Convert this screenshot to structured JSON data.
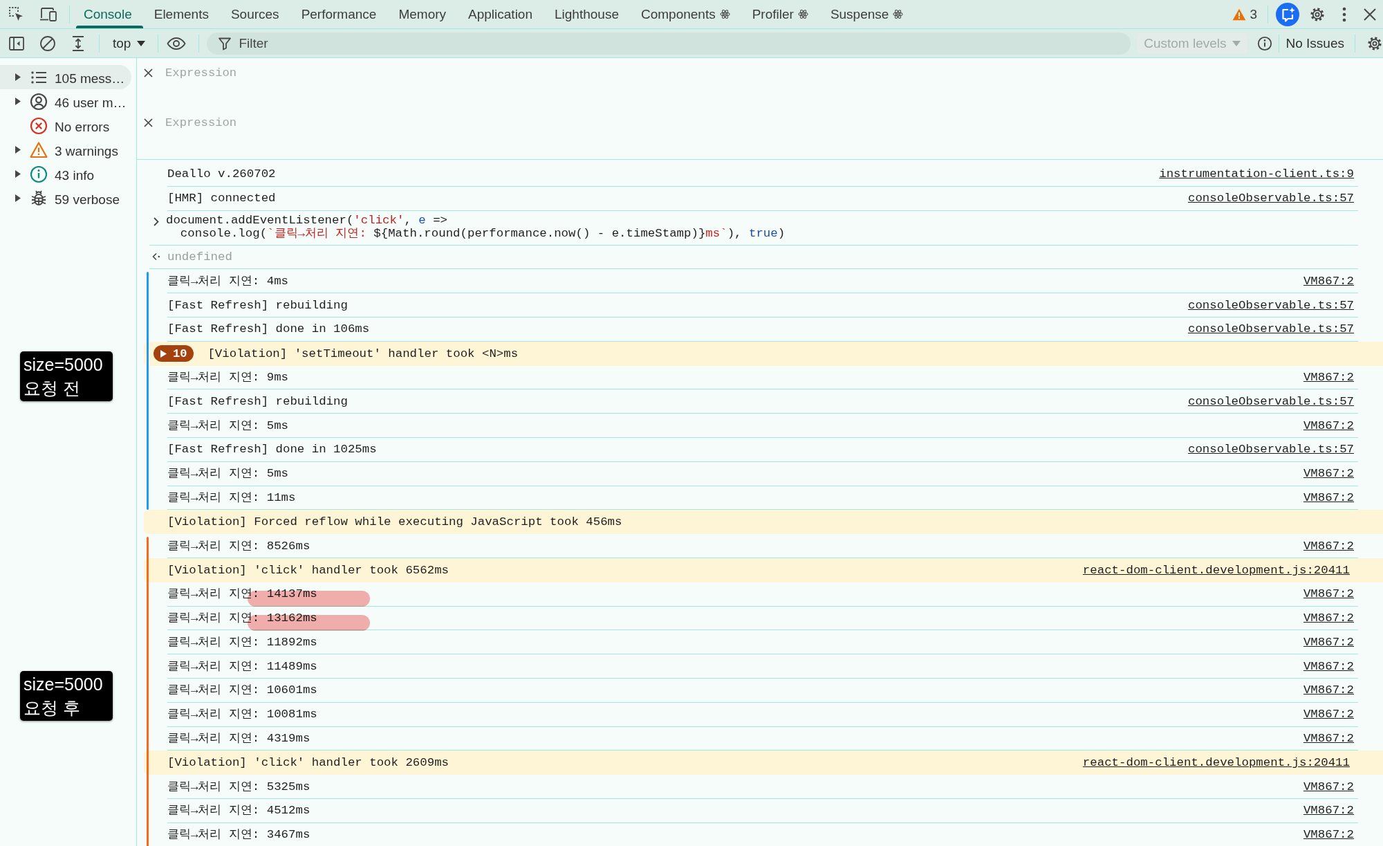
{
  "devtools_tabs": {
    "tabs": [
      {
        "label": "Console",
        "kind": "builtin",
        "selected": true
      },
      {
        "label": "Elements",
        "kind": "builtin",
        "selected": false
      },
      {
        "label": "Sources",
        "kind": "builtin",
        "selected": false
      },
      {
        "label": "Performance",
        "kind": "builtin",
        "selected": false
      },
      {
        "label": "Memory",
        "kind": "builtin",
        "selected": false
      },
      {
        "label": "Application",
        "kind": "builtin",
        "selected": false
      },
      {
        "label": "Lighthouse",
        "kind": "builtin",
        "selected": false
      },
      {
        "label": "Components",
        "kind": "react",
        "selected": false
      },
      {
        "label": "Profiler",
        "kind": "react",
        "selected": false
      },
      {
        "label": "Suspense",
        "kind": "react",
        "selected": false
      }
    ],
    "issues_count": "3"
  },
  "console_toolbar": {
    "context": "top",
    "filter": {
      "placeholder": "Filter"
    },
    "levels": {
      "label": "Custom levels",
      "disabled": true
    },
    "issues": "No Issues"
  },
  "sidebar": {
    "items": [
      {
        "label": "105 mess…",
        "kind": "messages",
        "expandable": true,
        "selected": true
      },
      {
        "label": "46 user m…",
        "kind": "user",
        "expandable": true,
        "selected": false
      },
      {
        "label": "No errors",
        "kind": "errors",
        "expandable": false,
        "selected": false
      },
      {
        "label": "3 warnings",
        "kind": "warnings",
        "expandable": true,
        "selected": false
      },
      {
        "label": "43 info",
        "kind": "info",
        "expandable": true,
        "selected": false
      },
      {
        "label": "59 verbose",
        "kind": "verbose",
        "expandable": true,
        "selected": false
      }
    ]
  },
  "live_expressions": [
    {
      "placeholder": "Expression"
    },
    {
      "placeholder": "Expression"
    }
  ],
  "console": {
    "groups": [
      {
        "rows": [
          {
            "kind": "log",
            "text": "Deallo v.260702",
            "source": "instrumentation-client.ts:9",
            "highlighted": false
          },
          {
            "kind": "log",
            "text": "[HMR] connected",
            "source": "consoleObservable.ts:57",
            "highlighted": false
          },
          {
            "kind": "command",
            "highlighted": false,
            "lines": [
              [
                {
                  "kind": "plain",
                  "text": "document.addEventListener("
                },
                {
                  "kind": "string",
                  "text": "'click'"
                },
                {
                  "kind": "plain",
                  "text": ", "
                },
                {
                  "kind": "keyword",
                  "text": "e"
                },
                {
                  "kind": "plain",
                  "text": " =>"
                }
              ],
              [
                {
                  "kind": "plain",
                  "text": "console.log("
                },
                {
                  "kind": "string",
                  "text": "`클릭→처리 지연: "
                },
                {
                  "kind": "plain",
                  "text": "${Math.round(performance.now() - e.timeStamp)}"
                },
                {
                  "kind": "string",
                  "text": "ms`"
                },
                {
                  "kind": "plain",
                  "text": "), "
                },
                {
                  "kind": "keyword",
                  "text": "true"
                },
                {
                  "kind": "plain",
                  "text": ")"
                }
              ]
            ]
          },
          {
            "kind": "result",
            "text": "undefined",
            "highlighted": false
          }
        ]
      },
      {
        "color": "#1e9bf5",
        "rows": [
          {
            "kind": "log",
            "text": "클릭→처리 지연: 4ms",
            "source": "VM867:2",
            "highlighted": false
          },
          {
            "kind": "log",
            "text": "[Fast Refresh] rebuilding",
            "source": "consoleObservable.ts:57",
            "highlighted": false
          },
          {
            "kind": "log",
            "text": "[Fast Refresh] done in 106ms",
            "source": "consoleObservable.ts:57",
            "highlighted": false
          },
          {
            "kind": "violation",
            "count": "10",
            "text": "[Violation] 'setTimeout' handler took <N>ms",
            "highlighted": false
          },
          {
            "kind": "log",
            "text": "클릭→처리 지연: 9ms",
            "source": "VM867:2",
            "highlighted": false
          },
          {
            "kind": "log",
            "text": "[Fast Refresh] rebuilding",
            "source": "consoleObservable.ts:57",
            "highlighted": false
          },
          {
            "kind": "log",
            "text": "클릭→처리 지연: 5ms",
            "source": "VM867:2",
            "highlighted": false
          },
          {
            "kind": "log",
            "text": "[Fast Refresh] done in 1025ms",
            "source": "consoleObservable.ts:57",
            "highlighted": false
          },
          {
            "kind": "log",
            "text": "클릭→처리 지연: 5ms",
            "source": "VM867:2",
            "highlighted": false
          },
          {
            "kind": "log",
            "text": "클릭→처리 지연: 11ms",
            "source": "VM867:2",
            "highlighted": false
          }
        ]
      },
      {
        "rows": [
          {
            "kind": "violation",
            "text": "[Violation] Forced reflow while executing JavaScript took 456ms",
            "highlighted": false
          }
        ]
      },
      {
        "color": "#f76b1c",
        "rows": [
          {
            "kind": "log",
            "text": "클릭→처리 지연: 8526ms",
            "source": "VM867:2",
            "highlighted": false
          },
          {
            "kind": "violation",
            "text": "[Violation] 'click' handler took 6562ms",
            "source": "react-dom-client.development.js:20411",
            "highlighted": false
          },
          {
            "kind": "log",
            "text": "클릭→처리 지연: 14137ms",
            "source": "VM867:2",
            "highlighted": true
          },
          {
            "kind": "log",
            "text": "클릭→처리 지연: 13162ms",
            "source": "VM867:2",
            "highlighted": true
          },
          {
            "kind": "log",
            "text": "클릭→처리 지연: 11892ms",
            "source": "VM867:2",
            "highlighted": false
          },
          {
            "kind": "log",
            "text": "클릭→처리 지연: 11489ms",
            "source": "VM867:2",
            "highlighted": false
          },
          {
            "kind": "log",
            "text": "클릭→처리 지연: 10601ms",
            "source": "VM867:2",
            "highlighted": false
          },
          {
            "kind": "log",
            "text": "클릭→처리 지연: 10081ms",
            "source": "VM867:2",
            "highlighted": false
          },
          {
            "kind": "log",
            "text": "클릭→처리 지연: 4319ms",
            "source": "VM867:2",
            "highlighted": false
          },
          {
            "kind": "violation",
            "text": "[Violation] 'click' handler took 2609ms",
            "source": "react-dom-client.development.js:20411",
            "highlighted": false
          },
          {
            "kind": "log",
            "text": "클릭→처리 지연: 5325ms",
            "source": "VM867:2",
            "highlighted": false
          },
          {
            "kind": "log",
            "text": "클릭→처리 지연: 4512ms",
            "source": "VM867:2",
            "highlighted": false
          },
          {
            "kind": "log",
            "text": "클릭→처리 지연: 3467ms",
            "source": "VM867:2",
            "highlighted": false
          }
        ]
      }
    ]
  },
  "annotations": [
    {
      "lines": [
        "size=5000",
        "요청 전"
      ]
    },
    {
      "lines": [
        "size=5000",
        "요청 후"
      ]
    }
  ]
}
